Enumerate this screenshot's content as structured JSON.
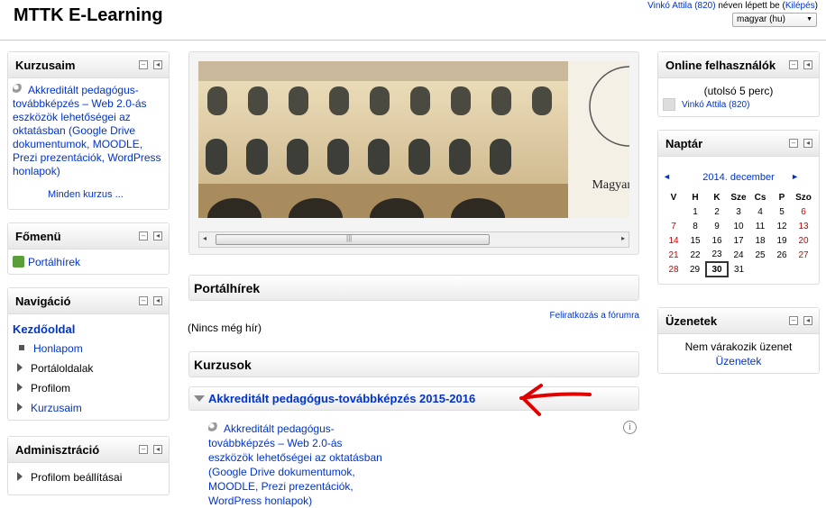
{
  "header": {
    "site_title": "MTTK E-Learning",
    "user_link": "Vinkó Attila (820)",
    "login_text": " néven lépett be (",
    "logout": "Kilépés",
    "login_close": ")",
    "language": "magyar (hu)"
  },
  "my_courses": {
    "title": "Kurzusaim",
    "course": "Akkreditált pedagógus-továbbképzés – Web 2.0-ás eszközök lehetőségei az oktatásban (Google Drive dokumentumok, MOODLE, Prezi prezentációk, WordPress honlapok)",
    "all": "Minden kurzus ..."
  },
  "main_menu": {
    "title": "Főmenü",
    "item": "Portálhírek"
  },
  "navigation": {
    "title": "Navigáció",
    "home": "Kezdőoldal",
    "items": [
      "Honlapom",
      "Portáloldalak",
      "Profilom",
      "Kurzusaim"
    ]
  },
  "admin": {
    "title": "Adminisztráció",
    "item": "Profilom beállításai"
  },
  "news": {
    "title": "Portálhírek",
    "subscribe": "Feliratkozás a fórumra",
    "empty": "(Nincs még hír)"
  },
  "courses": {
    "title": "Kurzusok",
    "category": "Akkreditált pedagógus-továbbképzés 2015-2016",
    "course": "Akkreditált pedagógus-továbbképzés – Web 2.0-ás eszközök lehetőségei az oktatásban (Google Drive dokumentumok, MOODLE, Prezi prezentációk, WordPress honlapok)"
  },
  "online": {
    "title": "Online felhasználók",
    "period": "(utolsó 5 perc)",
    "user": "Vinkó Attila (820)"
  },
  "calendar": {
    "title": "Naptár",
    "month": "2014. december",
    "days": [
      "V",
      "H",
      "K",
      "Sze",
      "Cs",
      "P",
      "Szo"
    ],
    "weeks": [
      [
        "",
        "1",
        "2",
        "3",
        "4",
        "5",
        "6"
      ],
      [
        "7",
        "8",
        "9",
        "10",
        "11",
        "12",
        "13"
      ],
      [
        "14",
        "15",
        "16",
        "17",
        "18",
        "19",
        "20"
      ],
      [
        "21",
        "22",
        "23",
        "24",
        "25",
        "26",
        "27"
      ],
      [
        "28",
        "29",
        "30",
        "31",
        "",
        "",
        ""
      ]
    ],
    "today": "30"
  },
  "messages": {
    "title": "Üzenetek",
    "empty": "Nem várakozik üzenet",
    "link": "Üzenetek"
  },
  "banner": {
    "caption": "Magyar"
  },
  "accent_colors": {
    "link": "#0033cc",
    "annotation_arrow": "#e00000",
    "weekend": "#cc0000"
  }
}
